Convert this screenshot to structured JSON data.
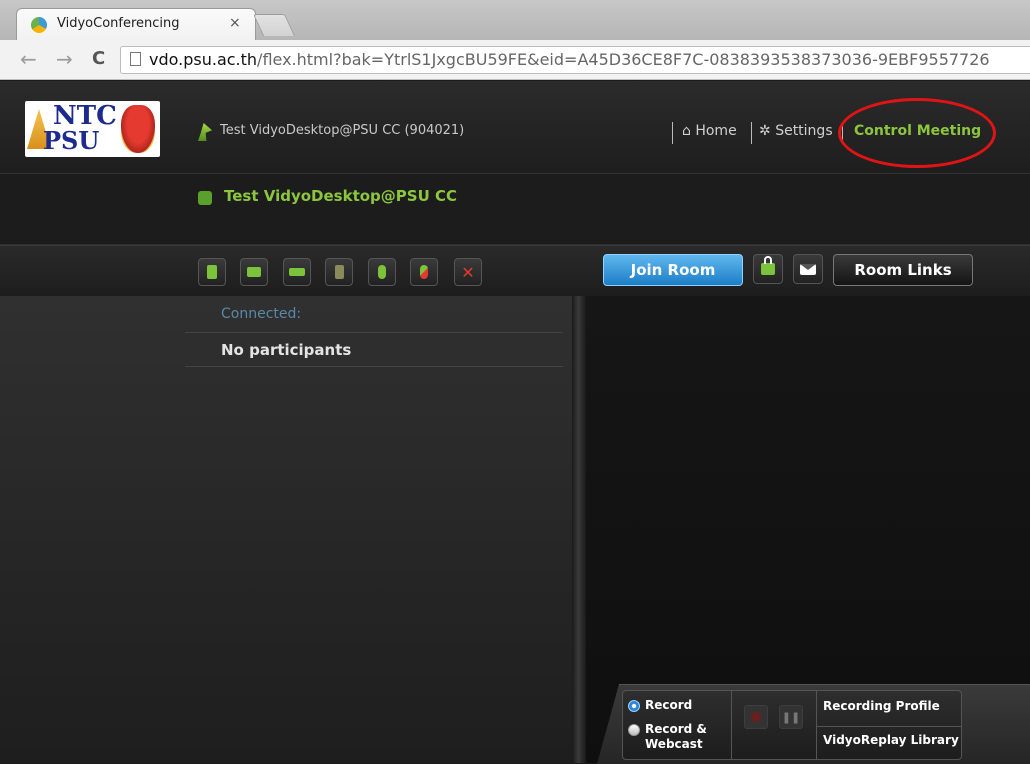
{
  "browser": {
    "tab_title": "VidyoConferencing",
    "tab_close": "×",
    "back_glyph": "←",
    "forward_glyph": "→",
    "reload_glyph": "C",
    "url_host": "vdo.psu.ac.th",
    "url_path": "/flex.html?bak=YtrlS1JxgcBU59FE&eid=A45D36CE8F7C-0838393538373036-9EBF9557726"
  },
  "logo": {
    "top": "NTC",
    "bottom": "PSU"
  },
  "header": {
    "user_label": "Test VidyoDesktop@PSU CC (904021)",
    "home_icon": "home-icon",
    "home_label": "Home",
    "settings_icon": "gear-icon",
    "settings_label": "Settings",
    "control_meeting_label": "Control Meeting"
  },
  "room": {
    "name": "Test VidyoDesktop@PSU CC"
  },
  "toolbar": {
    "icons": [
      "add-participant-icon",
      "camera-icon",
      "speaker-icon",
      "mute-video-icon",
      "microphone-icon",
      "mute-audio-icon",
      "disconnect-icon"
    ],
    "join_room_label": "Join Room",
    "lock_icon": "lock-icon",
    "invite_icon": "envelope-icon",
    "room_links_label": "Room Links"
  },
  "participants": {
    "status_label": "Connected:",
    "empty_label": "No participants"
  },
  "recording": {
    "record_label": "Record",
    "record_webcast_line1": "Record &",
    "record_webcast_line2": "Webcast",
    "record_selected": "Record",
    "profile_label": "Recording Profile",
    "library_label": "VidyoReplay Library"
  },
  "colors": {
    "accent_green": "#8cc63f",
    "join_blue": "#1d7ec7",
    "annotation_red": "#e01414",
    "connected_blue": "#5a88a8"
  }
}
